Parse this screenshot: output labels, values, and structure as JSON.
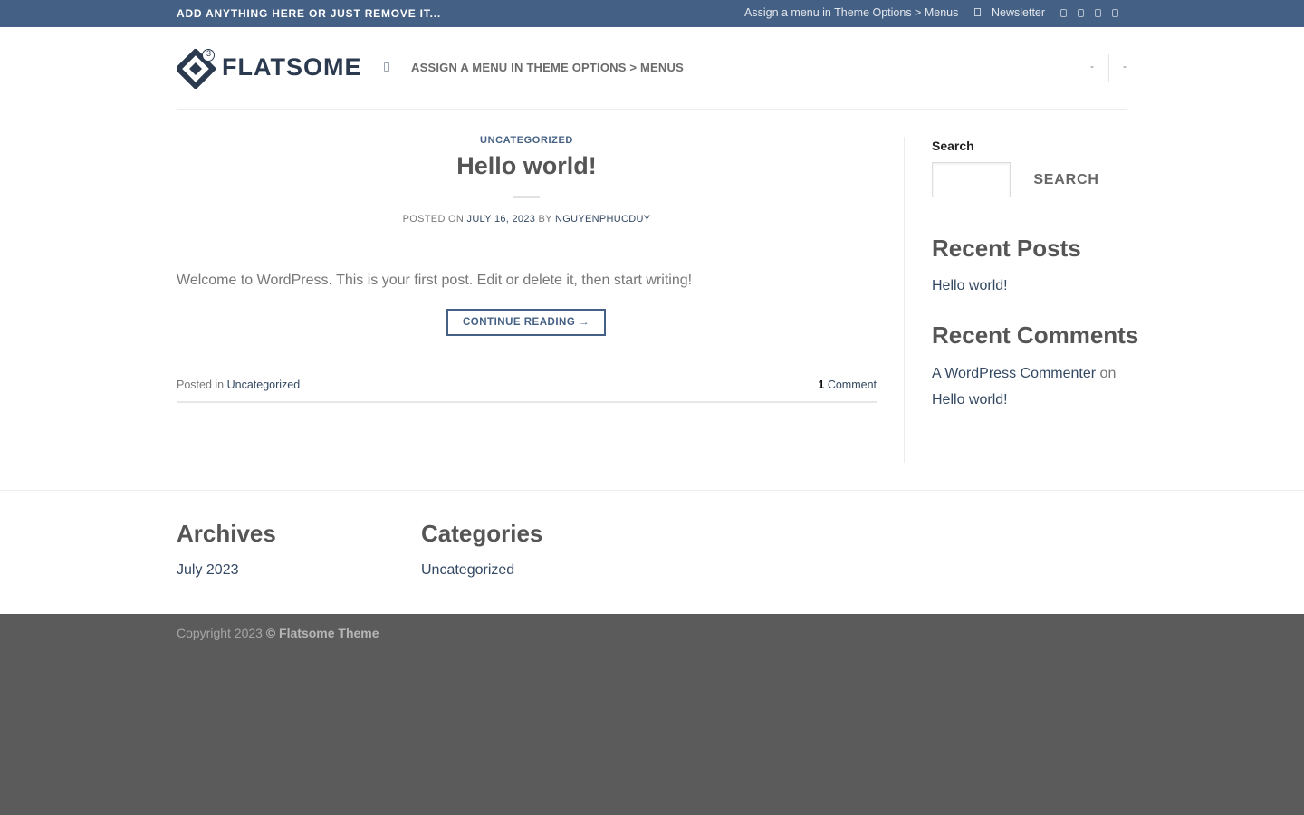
{
  "colors": {
    "topbar_bg": "#446084",
    "primary": "#446084",
    "link": "#334862",
    "footer_bg": "#5b5b5b"
  },
  "topbar": {
    "left_text": "ADD ANYTHING HERE OR JUST REMOVE IT...",
    "menu_text": "Assign a menu in Theme Options > Menus",
    "newsletter_label": "Newsletter",
    "social_icons": [
      "facebook-icon",
      "instagram-icon",
      "twitter-icon",
      "email-icon"
    ]
  },
  "header": {
    "logo_text": "FLATSOME",
    "logo_badge": "3",
    "nav_text": "ASSIGN A MENU IN THEME OPTIONS > MENUS",
    "right_items": [
      "-",
      "-"
    ]
  },
  "post": {
    "category": "UNCATEGORIZED",
    "title": "Hello world!",
    "meta_posted_on": "POSTED ON",
    "meta_date": "JULY 16, 2023",
    "meta_by": "BY",
    "meta_author": "NGUYENPHUCDUY",
    "excerpt": "Welcome to WordPress. This is your first post. Edit or delete it, then start writing!",
    "continue_label": "CONTINUE READING →",
    "posted_in_label": "Posted in",
    "posted_in_category": "Uncategorized",
    "comments_count": "1",
    "comments_label": "Comment"
  },
  "sidebar": {
    "search_label": "Search",
    "search_value": "",
    "search_button": "SEARCH",
    "recent_posts_heading": "Recent Posts",
    "recent_posts": [
      "Hello world!"
    ],
    "recent_comments_heading": "Recent Comments",
    "recent_comment_author": "A WordPress Commenter",
    "recent_comment_on": "on",
    "recent_comment_post": "Hello world!"
  },
  "footer_widgets": {
    "archives_heading": "Archives",
    "archives_item": "July 2023",
    "categories_heading": "Categories",
    "categories_item": "Uncategorized"
  },
  "footer": {
    "copyright_prefix": "Copyright 2023",
    "copyright_brand": "© Flatsome Theme"
  }
}
